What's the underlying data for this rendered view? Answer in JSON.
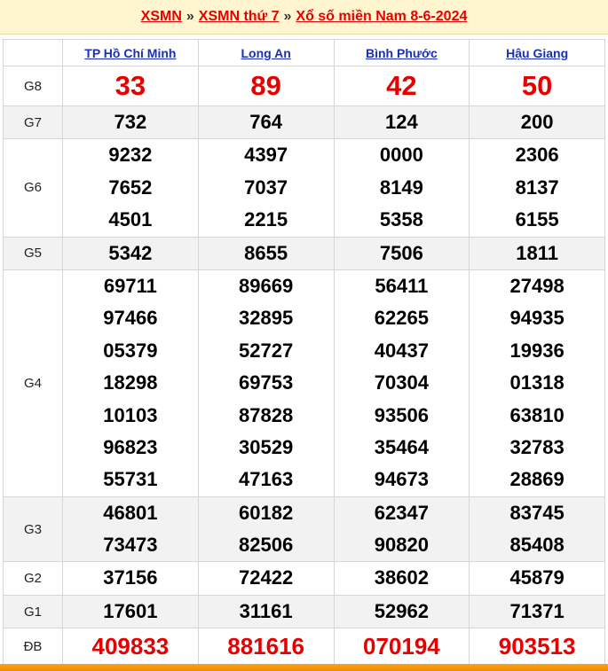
{
  "header": {
    "link1": "XSMN",
    "sep1": "»",
    "link2": "XSMN thứ 7",
    "sep2": "»",
    "link3": "Xổ số miền Nam 8-6-2024"
  },
  "provinces": [
    "TP Hồ Chí Minh",
    "Long An",
    "Bình Phước",
    "Hậu Giang"
  ],
  "prizes": [
    {
      "label": "G8",
      "style": "big",
      "alt": false,
      "values": [
        [
          "33"
        ],
        [
          "89"
        ],
        [
          "42"
        ],
        [
          "50"
        ]
      ]
    },
    {
      "label": "G7",
      "style": "num",
      "alt": true,
      "values": [
        [
          "732"
        ],
        [
          "764"
        ],
        [
          "124"
        ],
        [
          "200"
        ]
      ]
    },
    {
      "label": "G6",
      "style": "num",
      "alt": false,
      "values": [
        [
          "9232",
          "7652",
          "4501"
        ],
        [
          "4397",
          "7037",
          "2215"
        ],
        [
          "0000",
          "8149",
          "5358"
        ],
        [
          "2306",
          "8137",
          "6155"
        ]
      ]
    },
    {
      "label": "G5",
      "style": "num",
      "alt": true,
      "values": [
        [
          "5342"
        ],
        [
          "8655"
        ],
        [
          "7506"
        ],
        [
          "1811"
        ]
      ]
    },
    {
      "label": "G4",
      "style": "num",
      "alt": false,
      "values": [
        [
          "69711",
          "97466",
          "05379",
          "18298",
          "10103",
          "96823",
          "55731"
        ],
        [
          "89669",
          "32895",
          "52727",
          "69753",
          "87828",
          "30529",
          "47163"
        ],
        [
          "56411",
          "62265",
          "40437",
          "70304",
          "93506",
          "35464",
          "94673"
        ],
        [
          "27498",
          "94935",
          "19936",
          "01318",
          "63810",
          "32783",
          "28869"
        ]
      ]
    },
    {
      "label": "G3",
      "style": "num",
      "alt": true,
      "values": [
        [
          "46801",
          "73473"
        ],
        [
          "60182",
          "82506"
        ],
        [
          "62347",
          "90820"
        ],
        [
          "83745",
          "85408"
        ]
      ]
    },
    {
      "label": "G2",
      "style": "num",
      "alt": false,
      "values": [
        [
          "37156"
        ],
        [
          "72422"
        ],
        [
          "38602"
        ],
        [
          "45879"
        ]
      ]
    },
    {
      "label": "G1",
      "style": "num",
      "alt": true,
      "values": [
        [
          "17601"
        ],
        [
          "31161"
        ],
        [
          "52962"
        ],
        [
          "71371"
        ]
      ]
    },
    {
      "label": "ĐB",
      "style": "db",
      "alt": false,
      "values": [
        [
          "409833"
        ],
        [
          "881616"
        ],
        [
          "070194"
        ],
        [
          "903513"
        ]
      ]
    }
  ],
  "colors": {
    "accent": "#e60000",
    "link": "#1a2fb5",
    "header_bg": "#fff6cf",
    "footer": "#f08c00"
  }
}
